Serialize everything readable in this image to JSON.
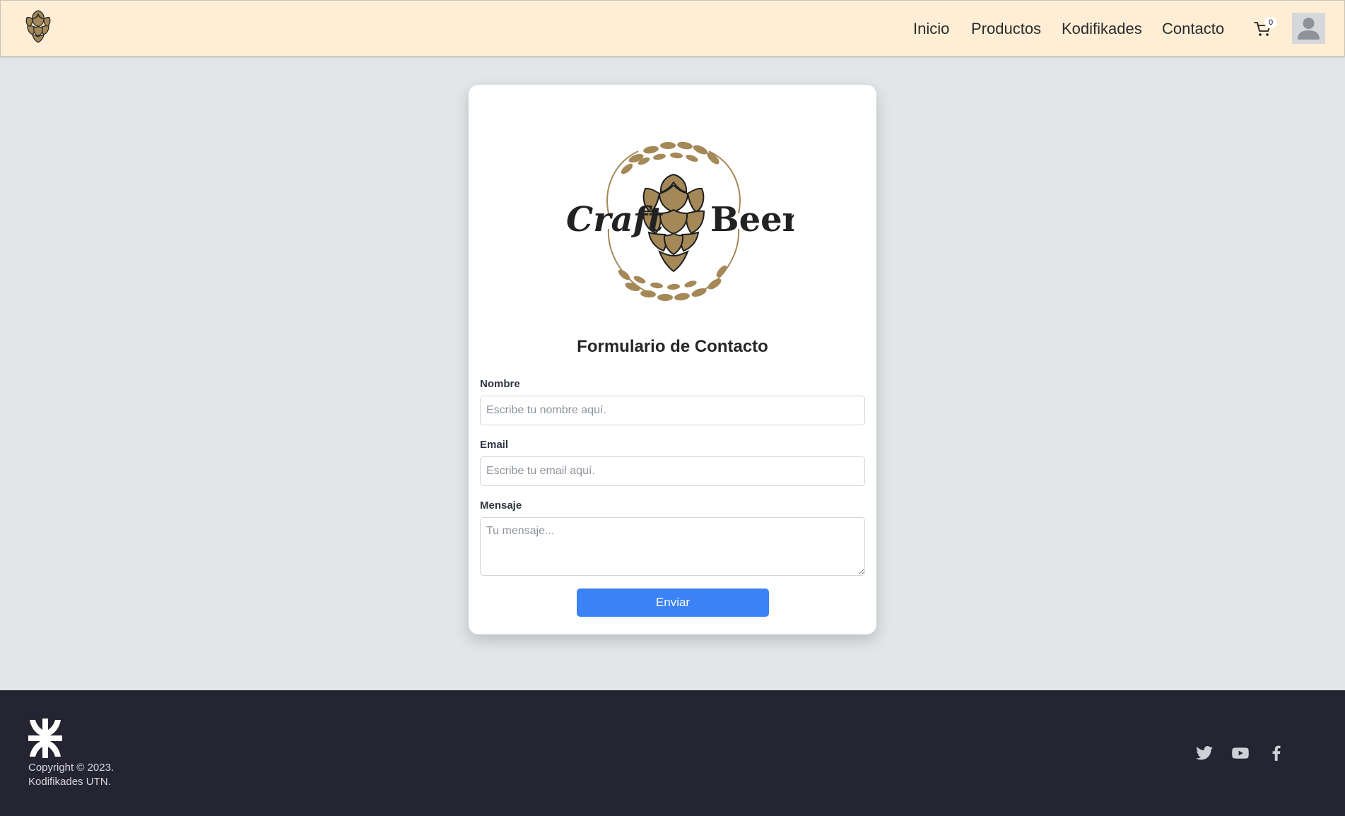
{
  "header": {
    "nav": [
      {
        "label": "Inicio"
      },
      {
        "label": "Productos"
      },
      {
        "label": "Kodifikades"
      },
      {
        "label": "Contacto"
      }
    ],
    "cart_count": "0",
    "icons": {
      "logo": "hop-cone-icon",
      "cart": "shopping-cart-icon",
      "avatar": "user-avatar-icon"
    }
  },
  "card": {
    "logo": {
      "word_left": "Craft",
      "word_right": "Beer"
    },
    "title": "Formulario de Contacto",
    "fields": {
      "name": {
        "label": "Nombre",
        "placeholder": "Escribe tu nombre aquí."
      },
      "email": {
        "label": "Email",
        "placeholder": "Escribe tu email aquí."
      },
      "message": {
        "label": "Mensaje",
        "placeholder": "Tu mensaje..."
      }
    },
    "submit_label": "Enviar"
  },
  "footer": {
    "copyright_line1": "Copyright © 2023.",
    "copyright_line2": "Kodifikades UTN.",
    "social": [
      "twitter-icon",
      "youtube-icon",
      "facebook-icon"
    ]
  },
  "colors": {
    "header_bg": "#ffeed6",
    "page_bg": "#e2e6e8",
    "accent": "#3b82f6",
    "footer_bg": "#252433",
    "hop": "#a48857"
  }
}
